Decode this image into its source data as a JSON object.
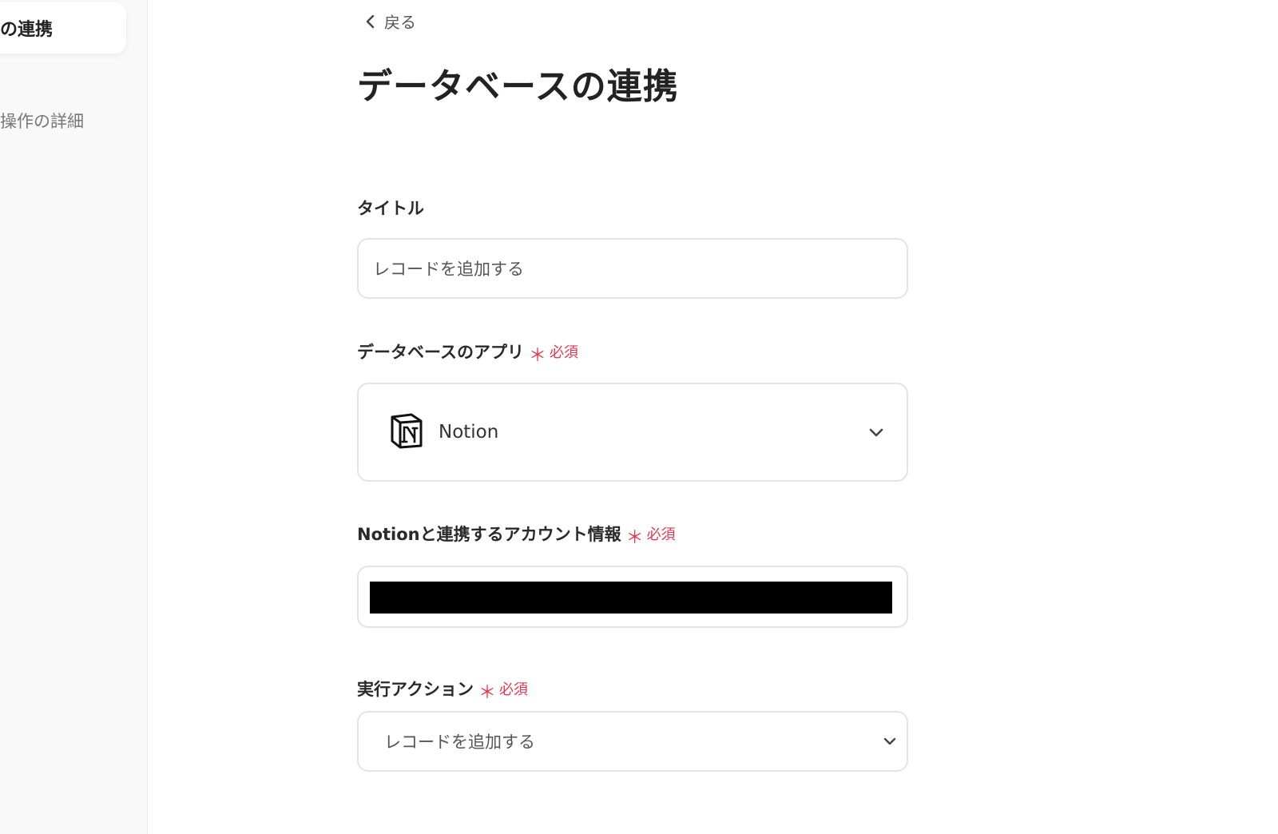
{
  "sidebar": {
    "active_item": "の連携",
    "item": "操作の詳細"
  },
  "header": {
    "back_label": "戻る",
    "title": "データベースの連携"
  },
  "form": {
    "title_field": {
      "label": "タイトル",
      "value": "レコードを追加する"
    },
    "app_field": {
      "label": "データベースのアプリ",
      "required_mark": "＊",
      "required_text": "必須",
      "selected_app": "Notion",
      "icon": "notion-logo-icon"
    },
    "account_field": {
      "label": "Notionと連携するアカウント情報",
      "required_mark": "＊",
      "required_text": "必須"
    },
    "action_field": {
      "label": "実行アクション",
      "required_mark": "＊",
      "required_text": "必須",
      "value": "レコードを追加する"
    }
  },
  "colors": {
    "required": "#e8384f",
    "border": "#e4e4e4",
    "sidebar_bg": "#f9f9f9"
  }
}
